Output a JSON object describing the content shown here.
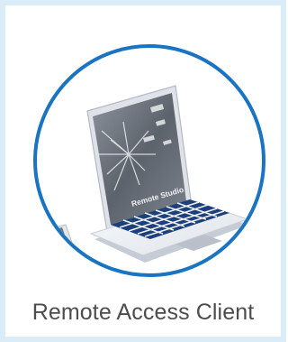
{
  "tile": {
    "label": "Remote Access Client",
    "icon": "laptop-remote-access-icon",
    "screen_text": "Remote Studio"
  },
  "colors": {
    "border": "#d9ecf8",
    "ring": "#1a74c2",
    "label": "#4d4d4d",
    "keyboard": "#1d3f7a",
    "laptop_body": "#eef1f5"
  }
}
